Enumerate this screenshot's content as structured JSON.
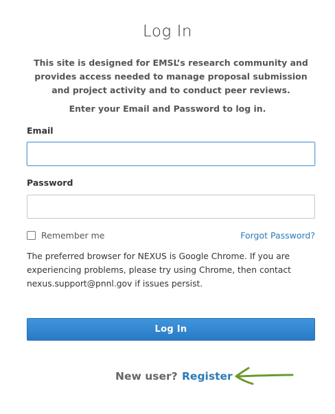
{
  "page": {
    "title": "Log In",
    "intro": "This site is designed for EMSL’s research community and provides access needed to manage proposal submission and project activity and to conduct peer reviews.",
    "instruction": "Enter your Email and Password to log in."
  },
  "form": {
    "email_label": "Email",
    "email_value": "",
    "password_label": "Password",
    "password_value": "",
    "remember_label": "Remember me",
    "remember_checked": false,
    "forgot_link": "Forgot Password?",
    "browser_note": "The preferred browser for NEXUS is Google Chrome. If you are experiencing problems, please try using Chrome, then contact nexus.support@pnnl.gov if issues persist.",
    "submit_label": "Log In"
  },
  "footer": {
    "new_user_text": "New user?",
    "register_link": "Register"
  },
  "colors": {
    "link": "#2a7ab8",
    "button": "#3f8fd4",
    "annotation_arrow": "#6a9a2c"
  },
  "icons": {
    "annotation": "hand-drawn-arrow-icon"
  }
}
